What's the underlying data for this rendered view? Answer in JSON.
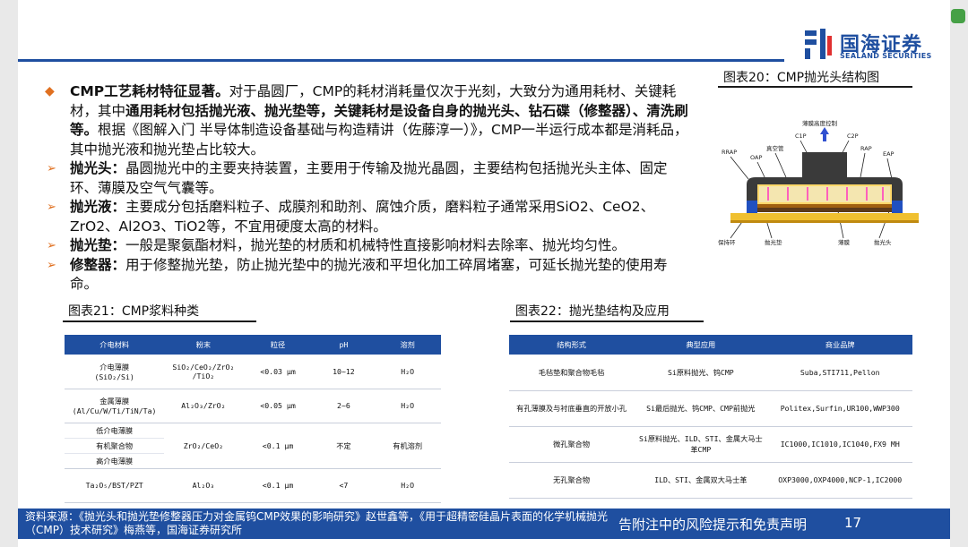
{
  "brand": {
    "name_cn": "国海证券",
    "name_en": "SEALAND SECURITIES",
    "color": "#1f4fa0",
    "accent": "#e07020"
  },
  "main": {
    "para1": {
      "lead": "CMP工艺耗材特征显著。",
      "t1": "对于晶圆厂，CMP的耗材消耗量仅次于光刻，大致分为通用耗材、关键耗材，其中",
      "b1": "通用耗材包括抛光液、抛光垫等，关键耗材是设备自身的抛光头、钻石碟（修整器）、清洗刷等。",
      "t2": "根据《图解入门 半导体制造设备基础与构造精讲（佐藤淳一）》，CMP一半运行成本都是消耗品，其中抛光液和抛光垫占比较大。"
    },
    "items": [
      {
        "term": "抛光头：",
        "text": "晶圆抛光中的主要夹持装置，主要用于传输及抛光晶圆，主要结构包括抛光头主体、固定环、薄膜及空气气囊等。"
      },
      {
        "term": "抛光液：",
        "text": "主要成分包括磨料粒子、成膜剂和助剂、腐蚀介质，磨料粒子通常采用SiO2、CeO2、ZrO2、Al2O3、TiO2等，不宜用硬度太高的材料。"
      },
      {
        "term": "抛光垫：",
        "text": "一般是聚氨酯材料，抛光垫的材质和机械特性直接影响材料去除率、抛光均匀性。"
      },
      {
        "term": "修整器：",
        "text": "用于修整抛光垫，防止抛光垫中的抛光液和平坦化加工碎屑堵塞，可延长抛光垫的使用寿命。"
      }
    ]
  },
  "fig20": {
    "title": "图表20：CMP抛光头结构图",
    "labels": {
      "ctrl": "薄膜高度控制",
      "c1p": "C1P",
      "c2p": "C2P",
      "vac": "真空管",
      "rrap": "RRAP",
      "oap": "OAP",
      "rap": "RAP",
      "eap": "EAP",
      "ring": "保持环",
      "pad": "抛光垫",
      "film": "薄膜",
      "head": "抛光头"
    }
  },
  "fig21": {
    "title": "图表21：CMP浆料种类",
    "headers": [
      "介电材料",
      "粉末",
      "粒径",
      "pH",
      "溶剂"
    ],
    "rows": [
      [
        "介电薄膜\n(SiO₂/Si)",
        "SiO₂/CeO₂/ZrO₂\n/TiO₂",
        "<0.03 μm",
        "10~12",
        "H₂O"
      ],
      [
        "金属薄膜\n(Al/Cu/W/Ti/TiN/Ta)",
        "Al₂O₃/ZrO₂",
        "<0.05 μm",
        "2~6",
        "H₂O"
      ],
      [
        "低介电薄膜",
        "ZrO₂/CeO₂",
        "<0.1 μm",
        "不定",
        "有机溶剂"
      ],
      [
        "有机聚合物",
        "",
        "",
        "",
        ""
      ],
      [
        "高介电薄膜",
        "",
        "",
        "",
        ""
      ],
      [
        "Ta₂O₅/BST/PZT",
        "Al₂O₃",
        "<0.1 μm",
        "<7",
        "H₂O"
      ]
    ]
  },
  "fig22": {
    "title": "图表22：抛光垫结构及应用",
    "headers": [
      "结构形式",
      "典型应用",
      "商业品牌"
    ],
    "rows": [
      [
        "毛毡垫和聚合物毛毡",
        "Si原料抛光、钨CMP",
        "Suba,STI711,Pellon"
      ],
      [
        "有孔薄膜及与衬底垂直的开放小孔",
        "Si最后抛光、钨CMP、CMP前抛光",
        "Politex,Surfin,UR100,WWP300"
      ],
      [
        "微孔聚合物",
        "Si原料抛光、ILD、STI、金属大马士革CMP",
        "IC1000,IC1010,IC1040,FX9 MH"
      ],
      [
        "无孔聚合物",
        "ILD、STI、金属双大马士革",
        "OXP3000,OXP4000,NCP-1,IC2000"
      ]
    ]
  },
  "footer": {
    "source": "资料来源：《抛光头和抛光垫修整器压力对金属钨CMP效果的影响研究》赵世鑫等，《用于超精密硅晶片表面的化学机械抛光（CMP）技术研究》梅燕等，国海证券研究所",
    "disclaimer": "告附注中的风险提示和免责声明",
    "page": "17"
  }
}
